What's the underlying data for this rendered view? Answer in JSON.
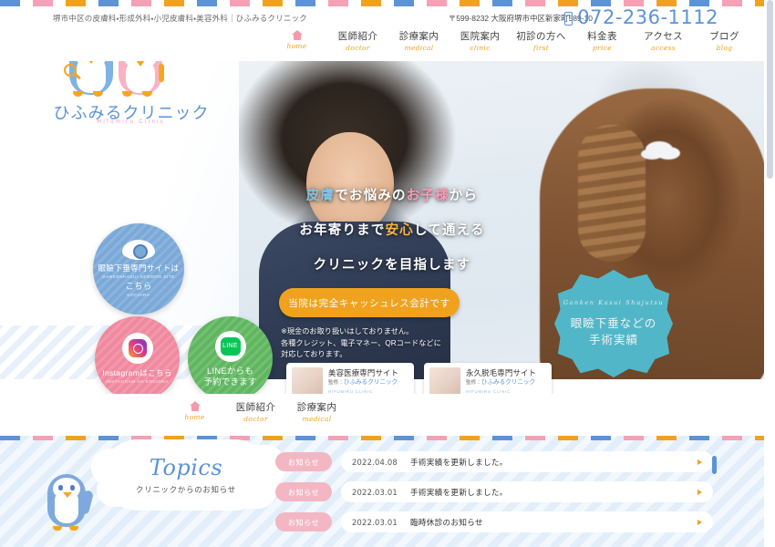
{
  "header": {
    "tagline": "堺市中区の皮膚科・形成外科・小児皮膚科・美容外科｜ひふみるクリニック",
    "address": "〒599-8232 大阪府堺市中区新家町589-10",
    "phone": "072-236-1112",
    "logo": {
      "name": "ひふみるクリニック",
      "romaji": "Hifumiru Clinic"
    }
  },
  "nav": {
    "items": [
      {
        "jp": "",
        "en": "home",
        "icon": "home-icon",
        "key": "home"
      },
      {
        "jp": "医師紹介",
        "en": "doctor",
        "key": "doctor"
      },
      {
        "jp": "診療案内",
        "en": "medical",
        "key": "medical"
      },
      {
        "jp": "医院案内",
        "en": "clinic",
        "key": "clinic"
      },
      {
        "jp": "初診の方へ",
        "en": "first",
        "key": "first"
      },
      {
        "jp": "料金表",
        "en": "price",
        "key": "price"
      },
      {
        "jp": "アクセス",
        "en": "access",
        "key": "access"
      },
      {
        "jp": "ブログ",
        "en": "blog",
        "key": "blog"
      }
    ]
  },
  "hero": {
    "line1_a": "皮膚",
    "line1_b": "でお悩みの",
    "line1_c": "お子様",
    "line1_d": "から",
    "line2_a": "お年寄りまで",
    "line2_b": "安心",
    "line2_c": "して通える",
    "line3": "クリニックを目指します",
    "cta_label": "当院は完全キャッシュレス会計です",
    "note_line1": "※現金のお取り扱いはしておりません。",
    "note_line2": "各種クレジット、電子マネー、QRコードなどに",
    "note_line3": "対応しております。",
    "badges": {
      "eye": {
        "jp": "眼瞼下垂専門サイトは",
        "en": "GANKENKASUI SENMON SITE",
        "jp2": "こちら",
        "en2": "KOCHIRA",
        "icon": "eye-icon",
        "color": "#7aa9d8"
      },
      "instagram": {
        "jp": "Instagramはこちら",
        "en": "INSTAGRAM HA KOCHIRA",
        "icon": "instagram-icon",
        "color": "#f0899f"
      },
      "line": {
        "jp1": "LINEからも",
        "jp2": "予約できます",
        "icon": "line-icon",
        "color": "#5fb65f",
        "glyph": "LINE"
      }
    },
    "starburst": {
      "en": "Ganken Kasui Shujutsu",
      "jp1": "眼瞼下垂などの",
      "jp2": "手術実績",
      "color": "#4fc0d4"
    },
    "subcards": [
      {
        "title": "美容医療専門サイト",
        "supervisor_prefix": "監修：",
        "supervisor": "ひふみるクリニック",
        "romaji": "HIFUMIRU CLINIC"
      },
      {
        "title": "永久脱毛専門サイト",
        "supervisor_prefix": "監修：",
        "supervisor": "ひふみるクリニック",
        "romaji": "HIFUMIRU CLINIC"
      }
    ]
  },
  "topics": {
    "title": "Topics",
    "subtitle": "クリニックからのお知らせ",
    "mascot": "penguin-mascot",
    "news": [
      {
        "badge": "お知らせ",
        "date": "2022.04.08",
        "title": "手術実績を更新しました。"
      },
      {
        "badge": "お知らせ",
        "date": "2022.03.01",
        "title": "手術実績を更新しました。"
      },
      {
        "badge": "お知らせ",
        "date": "2022.03.01",
        "title": "臨時休診のお知らせ"
      }
    ]
  },
  "colors": {
    "blue": "#5b93d6",
    "pink": "#f5a0b5",
    "orange": "#f0a21e",
    "teal": "#4fc0d4",
    "green": "#5fb65f"
  }
}
